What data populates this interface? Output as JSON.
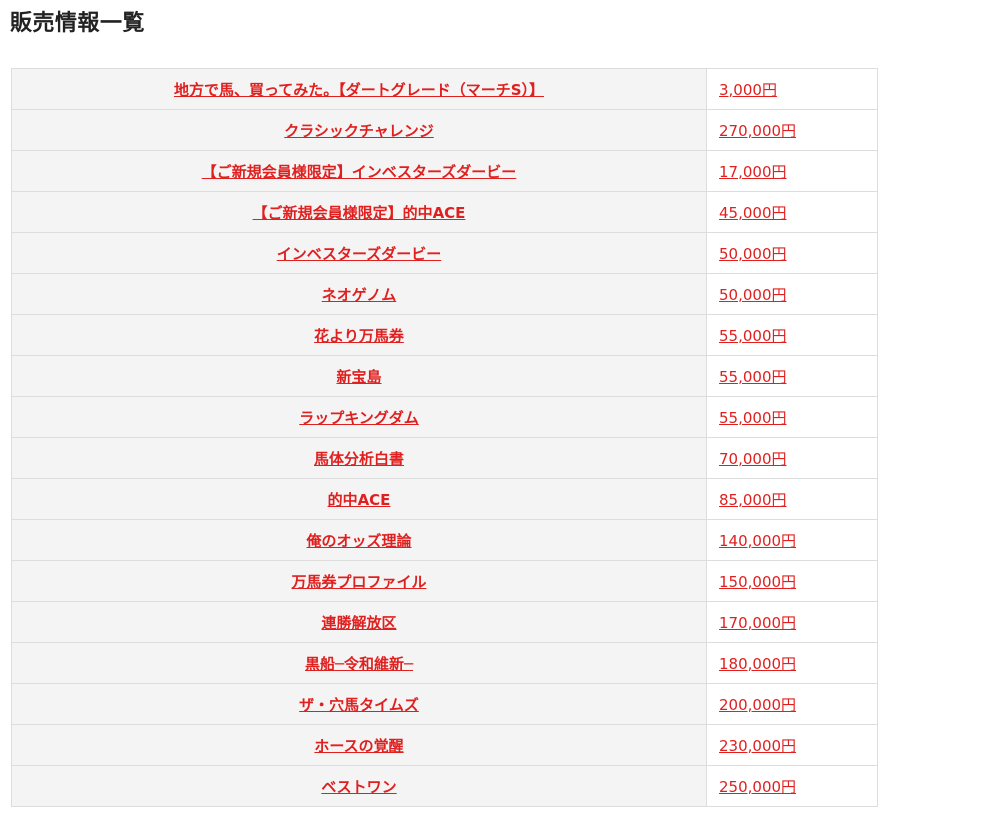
{
  "page": {
    "title": "販売情報一覧"
  },
  "colors": {
    "link": "#e0201f",
    "name_cell_bg": "#f4f4f4",
    "border": "#dddddd"
  },
  "table": {
    "rows": [
      {
        "name": "地方で馬、買ってみた。【ダートグレード（マーチS）】",
        "price": "3,000円"
      },
      {
        "name": "クラシックチャレンジ",
        "price": "270,000円"
      },
      {
        "name": "【ご新規会員様限定】インベスターズダービー",
        "price": "17,000円"
      },
      {
        "name": "【ご新規会員様限定】的中ACE",
        "price": "45,000円"
      },
      {
        "name": "インベスターズダービー",
        "price": "50,000円"
      },
      {
        "name": "ネオゲノム",
        "price": "50,000円"
      },
      {
        "name": "花より万馬券",
        "price": "55,000円"
      },
      {
        "name": "新宝島",
        "price": "55,000円"
      },
      {
        "name": "ラップキングダム",
        "price": "55,000円"
      },
      {
        "name": "馬体分析白書",
        "price": "70,000円"
      },
      {
        "name": "的中ACE",
        "price": "85,000円"
      },
      {
        "name": "俺のオッズ理論",
        "price": "140,000円"
      },
      {
        "name": "万馬券プロファイル",
        "price": "150,000円"
      },
      {
        "name": "連勝解放区",
        "price": "170,000円"
      },
      {
        "name": "黒船─令和維新─",
        "price": "180,000円"
      },
      {
        "name": "ザ・穴馬タイムズ",
        "price": "200,000円"
      },
      {
        "name": "ホースの覚醒",
        "price": "230,000円"
      },
      {
        "name": "ベストワン",
        "price": "250,000円"
      }
    ]
  }
}
